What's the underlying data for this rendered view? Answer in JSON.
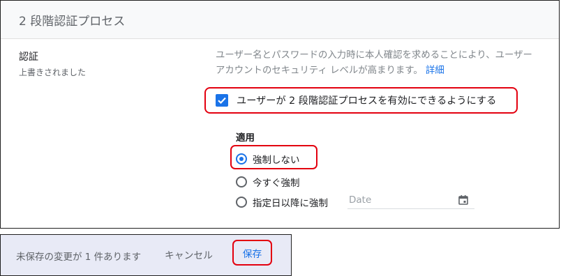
{
  "section": {
    "title": "2 段階認証プロセス"
  },
  "setting": {
    "label": "認証",
    "status": "上書きされました"
  },
  "description": {
    "text": "ユーザー名とパスワードの入力時に本人確認を求めることにより、ユーザー アカウントのセキュリティ レベルが高まります。",
    "link": "詳細"
  },
  "checkbox": {
    "label": "ユーザーが 2 段階認証プロセスを有効にできるようにする",
    "checked": true
  },
  "enforcement": {
    "title": "適用",
    "options": [
      {
        "label": "強制しない",
        "selected": true
      },
      {
        "label": "今すぐ強制",
        "selected": false
      },
      {
        "label": "指定日以降に強制",
        "selected": false
      }
    ],
    "date_placeholder": "Date"
  },
  "footer": {
    "unsaved_text": "未保存の変更が 1 件あります",
    "cancel_label": "キャンセル",
    "save_label": "保存"
  },
  "colors": {
    "accent": "#1a73e8",
    "highlight_border": "#e3000f",
    "footer_bg": "#e8eaf6"
  },
  "icons": {
    "checkbox": "check-icon",
    "date": "calendar-icon"
  }
}
